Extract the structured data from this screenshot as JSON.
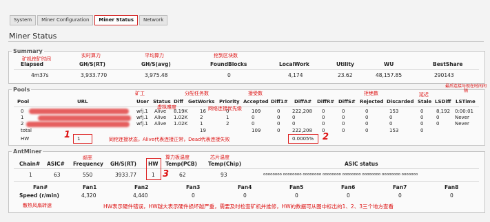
{
  "tabs": [
    "System",
    "Miner Configuration",
    "Miner Status",
    "Network"
  ],
  "page_title": "Miner Status",
  "summary": {
    "legend": "Summary",
    "headers": [
      "Elapsed",
      "GH/S(RT)",
      "GH/S(avg)",
      "FoundBlocks",
      "LocalWork",
      "Utility",
      "WU",
      "BestShare"
    ],
    "values": [
      "4m37s",
      "3,933.770",
      "3,975.48",
      "0",
      "4,174",
      "23.62",
      "48,157.85",
      "290143"
    ]
  },
  "pools": {
    "legend": "Pools",
    "headers": [
      "Pool",
      "URL",
      "User",
      "Status",
      "Diff",
      "GetWorks",
      "Priority",
      "Accepted",
      "Diff1#",
      "DiffA#",
      "DiffR#",
      "DiffS#",
      "Rejected",
      "Discarded",
      "Stale",
      "LSDiff",
      "LSTime"
    ],
    "rows": [
      [
        "0",
        "",
        "wfj.1",
        "Alive",
        "8.19K",
        "16",
        "0",
        "109",
        "0",
        "222,208",
        "0",
        "0",
        "0",
        "153",
        "0",
        "8,192",
        "0:00:01"
      ],
      [
        "1",
        "",
        "wfj.1",
        "Alive",
        "1.02K",
        "2",
        "1",
        "0",
        "0",
        "0",
        "0",
        "0",
        "0",
        "0",
        "0",
        "0",
        "Never"
      ],
      [
        "2",
        "",
        "wfj.1",
        "Alive",
        "1.02K",
        "1",
        "2",
        "0",
        "0",
        "0",
        "0",
        "0",
        "0",
        "0",
        "0",
        "0",
        "Never"
      ],
      [
        "total",
        "",
        "",
        "",
        "",
        "19",
        "",
        "109",
        "0",
        "222,208",
        "0",
        "0",
        "0",
        "153",
        "0",
        "",
        ""
      ],
      [
        "HW",
        "1",
        "",
        "",
        "",
        "",
        "",
        "",
        "",
        "0.0005%",
        "",
        "",
        "",
        "",
        "",
        "",
        ""
      ]
    ]
  },
  "antminer": {
    "legend": "AntMiner",
    "headers": [
      "Chain#",
      "ASIC#",
      "Frequency",
      "GH/S(RT)",
      "HW",
      "Temp(PCB)",
      "Temp(Chip)",
      "ASIC status"
    ],
    "values": [
      "1",
      "63",
      "550",
      "3933.77",
      "1",
      "62",
      "93",
      "oooooooo oooooooo oooooooo oooooooo oooooooo oooooooo oooooooo ooooooo"
    ],
    "fan_headers": [
      "Fan#",
      "Fan1",
      "Fan2",
      "Fan3",
      "Fan4",
      "Fan5",
      "Fan6",
      "Fan7",
      "Fan8"
    ],
    "fan_values": [
      "Speed (r/min)",
      "4,320",
      "4,440",
      "0",
      "0",
      "0",
      "0",
      "0",
      "0"
    ]
  },
  "annotations": {
    "a_elapsed": "矿机挖矿时间",
    "a_rt": "实时算力",
    "a_avg": "平均算力",
    "a_found": "挖到区块数",
    "a_miner": "矿工",
    "a_diff": "虚拟难度",
    "a_getworks": "分配任务数",
    "a_priority": "网络连接优先级",
    "a_accepted": "接受数",
    "a_rejected": "拒绝数",
    "a_stale": "延迟",
    "a_lstime": "最后连接与现在时间间隔",
    "a_status": "同挖连接状态，Alive代表连接正常，Dead代表连接失败",
    "a_freq": "频率",
    "a_pcb": "算力板温度",
    "a_chip": "芯片温度",
    "a_fan": "散热风扇转速",
    "a_hw": "HW表示硬件错误，HW越大表示硬件损坏越严重，需要及时检查矿机并维修，HW的数据可从图中标出的1、2、3三个地方查看",
    "n1": "1",
    "n2": "2",
    "n3": "3"
  },
  "colors": {
    "annotation": "#d11111",
    "accent": "#d52a2a"
  }
}
